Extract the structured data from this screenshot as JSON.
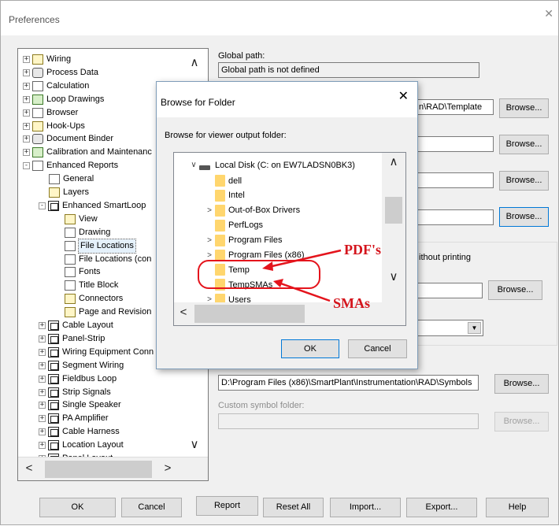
{
  "window": {
    "title": "Preferences",
    "close_glyph": "✕"
  },
  "tree": {
    "items": [
      {
        "label": "Wiring",
        "expander": "+",
        "icon": "wiring-icon"
      },
      {
        "label": "Process Data",
        "expander": "+",
        "icon": "process-data-icon"
      },
      {
        "label": "Calculation",
        "expander": "+",
        "icon": "calculator-icon"
      },
      {
        "label": "Loop Drawings",
        "expander": "+",
        "icon": "loop-icon"
      },
      {
        "label": "Browser",
        "expander": "+",
        "icon": "browser-icon"
      },
      {
        "label": "Hook-Ups",
        "expander": "+",
        "icon": "hook-icon"
      },
      {
        "label": "Document Binder",
        "expander": "+",
        "icon": "binder-icon"
      },
      {
        "label": "Calibration and Maintenanc",
        "expander": "+",
        "icon": "calibration-icon"
      },
      {
        "label": "Enhanced Reports",
        "expander": "-",
        "icon": "reports-icon"
      },
      {
        "label": "General",
        "icon": "general-icon"
      },
      {
        "label": "Layers",
        "icon": "layers-icon"
      },
      {
        "label": "Enhanced SmartLoop",
        "expander": "-",
        "icon": "smartloop-icon"
      },
      {
        "label": "View",
        "icon": "view-icon"
      },
      {
        "label": "Drawing",
        "icon": "drawing-icon"
      },
      {
        "label": "File Locations",
        "icon": "file-locations-icon"
      },
      {
        "label": "File Locations (con",
        "icon": "file-locations-icon"
      },
      {
        "label": "Fonts",
        "icon": "fonts-icon"
      },
      {
        "label": "Title Block",
        "icon": "title-block-icon"
      },
      {
        "label": "Connectors",
        "icon": "connectors-icon"
      },
      {
        "label": "Page and Revision",
        "icon": "page-revision-icon"
      },
      {
        "label": "Cable Layout",
        "expander": "+",
        "icon": "module-icon"
      },
      {
        "label": "Panel-Strip",
        "expander": "+",
        "icon": "module-icon"
      },
      {
        "label": "Wiring Equipment Conn",
        "expander": "+",
        "icon": "module-icon"
      },
      {
        "label": "Segment Wiring",
        "expander": "+",
        "icon": "module-icon"
      },
      {
        "label": "Fieldbus Loop",
        "expander": "+",
        "icon": "module-icon"
      },
      {
        "label": "Strip Signals",
        "expander": "+",
        "icon": "module-icon"
      },
      {
        "label": "Single Speaker",
        "expander": "+",
        "icon": "module-icon"
      },
      {
        "label": "PA Amplifier",
        "expander": "+",
        "icon": "module-icon"
      },
      {
        "label": "Cable Harness",
        "expander": "+",
        "icon": "module-icon"
      },
      {
        "label": "Location Layout",
        "expander": "+",
        "icon": "module-icon"
      },
      {
        "label": "Panel Layout",
        "expander": "+",
        "icon": "module-icon"
      }
    ],
    "scroll": {
      "up": "∧",
      "down": "∨",
      "left": "<",
      "right": ">"
    }
  },
  "right": {
    "global_path_label": "Global path:",
    "global_path_value": "Global path is not defined",
    "template_path_value": "n\\RAD\\Template",
    "without_printing": "ithout printing",
    "symbols_path_value": "D:\\Program Files (x86)\\SmartPlant\\Instrumentation\\RAD\\Symbols",
    "custom_symbol_label": "Custom symbol folder:",
    "custom_symbol_value": "",
    "browse_label": "Browse...",
    "dropdown_arrow": "▼"
  },
  "dialog": {
    "title": "Browse for Folder",
    "close_glyph": "✕",
    "prompt": "Browse for viewer output folder:",
    "drive": "Local Disk (C: on EW7LADSN0BK3)",
    "folders": [
      {
        "name": "dell",
        "chevron": ""
      },
      {
        "name": "Intel",
        "chevron": ""
      },
      {
        "name": "Out-of-Box Drivers",
        "chevron": ">"
      },
      {
        "name": "PerfLogs",
        "chevron": ""
      },
      {
        "name": "Program Files",
        "chevron": ">"
      },
      {
        "name": "Program Files (x86)",
        "chevron": ">"
      },
      {
        "name": "Temp",
        "chevron": ""
      },
      {
        "name": "TempSMAs",
        "chevron": ""
      },
      {
        "name": "Users",
        "chevron": ">"
      }
    ],
    "drive_chevron": "∨",
    "scroll": {
      "up": "∧",
      "down": "∨",
      "left": "<"
    },
    "ok": "OK",
    "cancel": "Cancel"
  },
  "annotations": {
    "pdfs": "PDF's",
    "smas": "SMAs",
    "color": "#d4141c"
  },
  "bottom_buttons": {
    "ok": "OK",
    "cancel": "Cancel",
    "report": "Report",
    "reset_all": "Reset All",
    "import": "Import...",
    "export": "Export...",
    "help": "Help"
  }
}
